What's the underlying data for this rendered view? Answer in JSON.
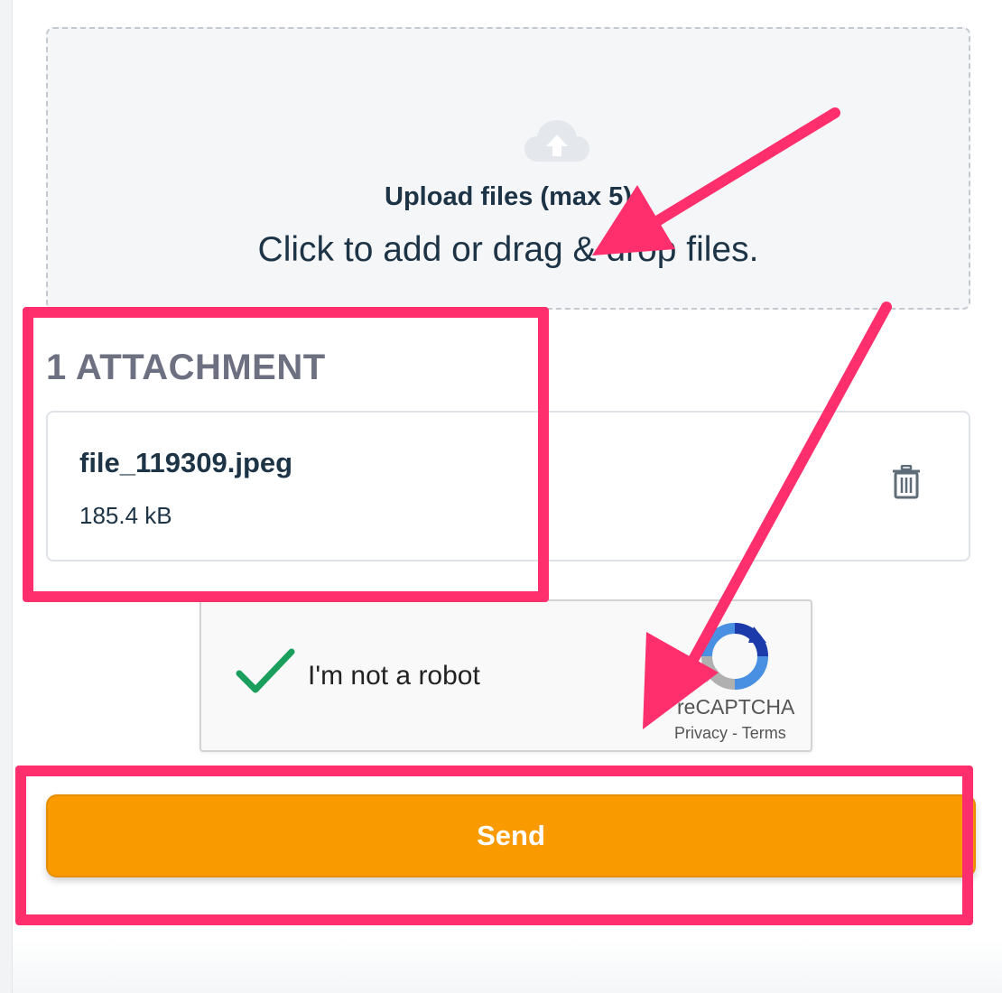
{
  "upload": {
    "title": "Upload files (max 5)",
    "subtitle": "Click to add or drag & drop files.",
    "icon": "cloud-upload-icon"
  },
  "attachments": {
    "heading": "1 ATTACHMENT",
    "items": [
      {
        "name": "file_119309.jpeg",
        "size": "185.4 kB",
        "delete_icon": "trash-icon"
      }
    ]
  },
  "captcha": {
    "label": "I'm not a robot",
    "checked": true,
    "brand": "reCAPTCHA",
    "privacy": "Privacy",
    "separator": "-",
    "terms": "Terms"
  },
  "actions": {
    "send_label": "Send"
  },
  "colors": {
    "primary": "#f99a00",
    "annotation": "#ff2e6d",
    "text": "#1d3447",
    "heading_muted": "#6c7080",
    "check": "#1a9e5b"
  }
}
